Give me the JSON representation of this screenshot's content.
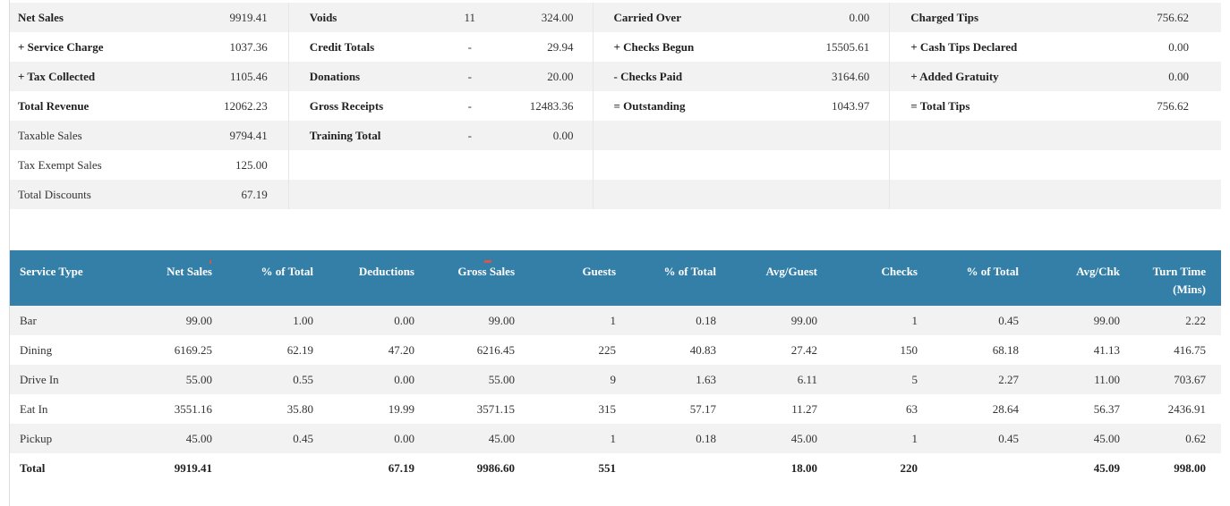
{
  "summary": {
    "col1": [
      {
        "label": "Net Sales",
        "value": "9919.41",
        "bold": true
      },
      {
        "label": "+ Service Charge",
        "value": "1037.36",
        "bold": true
      },
      {
        "label": "+ Tax Collected",
        "value": "1105.46",
        "bold": true
      },
      {
        "label": "Total Revenue",
        "value": "12062.23",
        "bold": true
      },
      {
        "label": "Taxable Sales",
        "value": "9794.41",
        "bold": false
      },
      {
        "label": "Tax Exempt Sales",
        "value": "125.00",
        "bold": false
      },
      {
        "label": "Total Discounts",
        "value": "67.19",
        "bold": false
      }
    ],
    "col2": [
      {
        "label": "Voids",
        "count": "11",
        "value": "324.00"
      },
      {
        "label": "Credit Totals",
        "count": "-",
        "value": "29.94"
      },
      {
        "label": "Donations",
        "count": "-",
        "value": "20.00"
      },
      {
        "label": "Gross Receipts",
        "count": "-",
        "value": "12483.36"
      },
      {
        "label": "Training Total",
        "count": "-",
        "value": "0.00"
      }
    ],
    "col3": [
      {
        "label": "Carried Over",
        "value": "0.00"
      },
      {
        "label": "+ Checks Begun",
        "value": "15505.61"
      },
      {
        "label": "- Checks Paid",
        "value": "3164.60"
      },
      {
        "label": "= Outstanding",
        "value": "1043.97"
      }
    ],
    "col4": [
      {
        "label": "Charged Tips",
        "value": "756.62"
      },
      {
        "label": "+ Cash Tips Declared",
        "value": "0.00"
      },
      {
        "label": "+ Added Gratuity",
        "value": "0.00"
      },
      {
        "label": "= Total Tips",
        "value": "756.62"
      }
    ]
  },
  "service_table": {
    "headers": {
      "type": "Service Type",
      "net": "Net Sales",
      "pct1": "% of Total",
      "ded": "Deductions",
      "gross": "Gross Sales",
      "guests": "Guests",
      "pct2": "% of Total",
      "avgg": "Avg/Guest",
      "checks": "Checks",
      "pct3": "% of Total",
      "avgc": "Avg/Chk",
      "turn1": "Turn Time",
      "turn2": "(Mins)"
    },
    "rows": [
      {
        "type": "Bar",
        "net": "99.00",
        "pct1": "1.00",
        "ded": "0.00",
        "gross": "99.00",
        "guests": "1",
        "pct2": "0.18",
        "avgg": "99.00",
        "checks": "1",
        "pct3": "0.45",
        "avgc": "99.00",
        "turn": "2.22"
      },
      {
        "type": "Dining",
        "net": "6169.25",
        "pct1": "62.19",
        "ded": "47.20",
        "gross": "6216.45",
        "guests": "225",
        "pct2": "40.83",
        "avgg": "27.42",
        "checks": "150",
        "pct3": "68.18",
        "avgc": "41.13",
        "turn": "416.75"
      },
      {
        "type": "Drive In",
        "net": "55.00",
        "pct1": "0.55",
        "ded": "0.00",
        "gross": "55.00",
        "guests": "9",
        "pct2": "1.63",
        "avgg": "6.11",
        "checks": "5",
        "pct3": "2.27",
        "avgc": "11.00",
        "turn": "703.67"
      },
      {
        "type": "Eat In",
        "net": "3551.16",
        "pct1": "35.80",
        "ded": "19.99",
        "gross": "3571.15",
        "guests": "315",
        "pct2": "57.17",
        "avgg": "11.27",
        "checks": "63",
        "pct3": "28.64",
        "avgc": "56.37",
        "turn": "2436.91"
      },
      {
        "type": "Pickup",
        "net": "45.00",
        "pct1": "0.45",
        "ded": "0.00",
        "gross": "45.00",
        "guests": "1",
        "pct2": "0.18",
        "avgg": "45.00",
        "checks": "1",
        "pct3": "0.45",
        "avgc": "45.00",
        "turn": "0.62"
      }
    ],
    "total": {
      "type": "Total",
      "net": "9919.41",
      "pct1": "",
      "ded": "67.19",
      "gross": "9986.60",
      "guests": "551",
      "pct2": "",
      "avgg": "18.00",
      "checks": "220",
      "pct3": "",
      "avgc": "45.09",
      "turn": "998.00"
    }
  },
  "colors": {
    "header_bg": "#337fa7",
    "stripe": "#f2f2f2",
    "sort_indicator": "#d9534f"
  }
}
